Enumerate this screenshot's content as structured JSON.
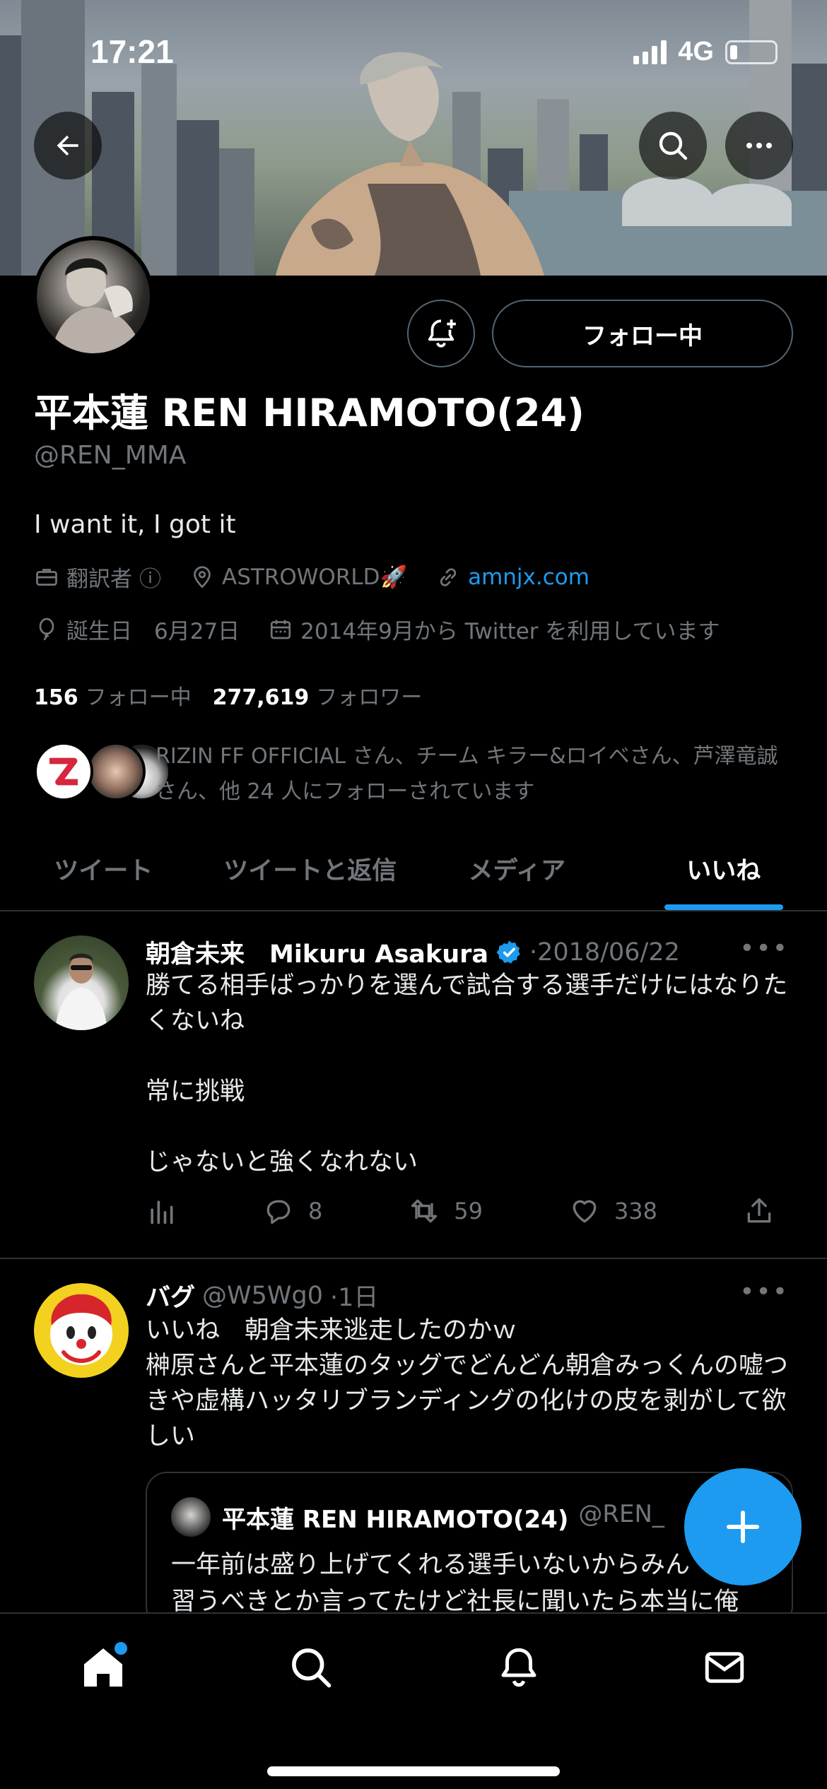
{
  "status_bar": {
    "time": "17:21",
    "network": "4G"
  },
  "profile": {
    "display_name": "平本蓮 REN HIRAMOTO(24)",
    "handle": "@REN_MMA",
    "bio": "I want it, I got it",
    "occupation": "翻訳者",
    "info_glyph": "ⓘ",
    "location": "ASTROWORLD🚀",
    "website": "amnjx.com",
    "birthday": "誕生日　6月27日",
    "joined": "2014年9月から Twitter を利用しています",
    "following_count": "156",
    "following_label": "フォロー中",
    "followers_count": "277,619",
    "followers_label": "フォロワー",
    "followed_by_text": "RIZIN FF OFFICIAL さん、チーム キラー&ロイベさん、芦澤竜誠さん、他 24 人にフォローされています",
    "follow_button_label": "フォロー中"
  },
  "tabs": [
    {
      "label": "ツイート",
      "active": false
    },
    {
      "label": "ツイートと返信",
      "active": false
    },
    {
      "label": "メディア",
      "active": false
    },
    {
      "label": "いいね",
      "active": true
    }
  ],
  "tweets": [
    {
      "name": "朝倉未来　Mikuru Asakura",
      "verified": true,
      "date": "·2018/06/22",
      "text": "勝てる相手ばっかりを選んで試合する選手だけにはなりたくないね\n\n常に挑戦\n\nじゃないと強くなれない",
      "replies": "8",
      "retweets": "59",
      "likes": "338",
      "more": "•••"
    },
    {
      "name": "バグ",
      "handle": "@W5Wg0",
      "date": "·1日",
      "text": "いいね　朝倉未来逃走したのかｗ\n榊原さんと平本蓮のタッグでどんどん朝倉みっくんの嘘つきや虚構ハッタリブランディングの化けの皮を剥がして欲しい",
      "more": "•••",
      "quote": {
        "name": "平本蓮 REN HIRAMOTO(24)",
        "handle": "@REN_",
        "text": "一年前は盛り上げてくれる選手いないからみん\n習うべきとか言ってたけど社長に聞いたら本当に俺"
      }
    }
  ],
  "colors": {
    "accent": "#1d9bf0",
    "background": "#000000",
    "muted": "#71767b",
    "border": "#2f3336"
  },
  "icons": [
    "back-arrow-icon",
    "search-icon",
    "more-icon",
    "bell-plus-icon",
    "briefcase-icon",
    "location-pin-icon",
    "link-icon",
    "balloon-icon",
    "calendar-icon",
    "analytics-icon",
    "reply-icon",
    "retweet-icon",
    "like-icon",
    "share-icon",
    "plus-icon",
    "home-icon",
    "bell-icon",
    "mail-icon"
  ]
}
